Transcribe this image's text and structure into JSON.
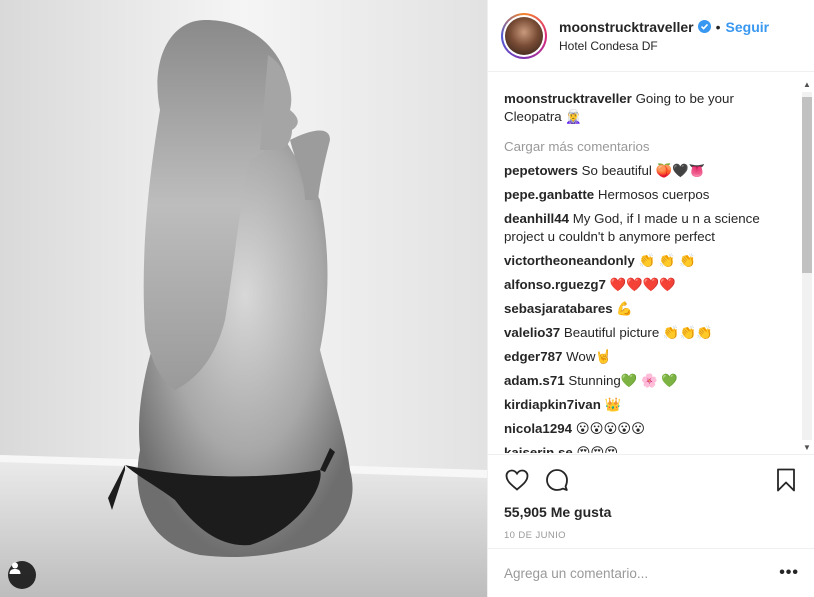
{
  "post": {
    "image_alt": "Black and white photo of a woman sitting on the edge of a bathtub, viewed from behind",
    "user_tag_icon": "user-tag-icon"
  },
  "header": {
    "username": "moonstrucktraveller",
    "verified_icon": "verified-badge-icon",
    "separator": "•",
    "follow_label": "Seguir",
    "location": "Hotel Condesa DF"
  },
  "caption": {
    "user": "moonstrucktraveller",
    "text": "Going to be your Cleopatra 🧝‍♀️"
  },
  "load_more_label": "Cargar más comentarios",
  "comments": [
    {
      "user": "pepetowers",
      "text": "So beautiful 🍑🖤👅"
    },
    {
      "user": "pepe.ganbatte",
      "text": "Hermosos cuerpos"
    },
    {
      "user": "deanhill44",
      "text": "My God, if I made u n a science project u couldn't b anymore perfect"
    },
    {
      "user": "victortheoneandonly",
      "text": "👏 👏 👏"
    },
    {
      "user": "alfonso.rguezg7",
      "text": "❤️❤️❤️❤️"
    },
    {
      "user": "sebasjaratabares",
      "text": "💪"
    },
    {
      "user": "valelio37",
      "text": "Beautiful picture 👏👏👏"
    },
    {
      "user": "edger787",
      "text": "Wow🤘"
    },
    {
      "user": "adam.s71",
      "text": "Stunning💚 🌸 💚"
    },
    {
      "user": "kirdiapkin7ivan",
      "text": "👑"
    },
    {
      "user": "nicola1294",
      "text": "😮😮😮😮😮"
    },
    {
      "user": "kaiserin.se",
      "text": "😍😍😍"
    }
  ],
  "actions": {
    "like_icon": "heart-icon",
    "comment_icon": "comment-icon",
    "save_icon": "bookmark-icon"
  },
  "likes_text": "55,905 Me gusta",
  "date": "10 DE JUNIO",
  "add_comment": {
    "placeholder": "Agrega un comentario...",
    "more_label": "•••"
  },
  "colors": {
    "link_blue": "#3897f0",
    "text": "#262626",
    "muted": "#999999",
    "border": "#efefef"
  }
}
